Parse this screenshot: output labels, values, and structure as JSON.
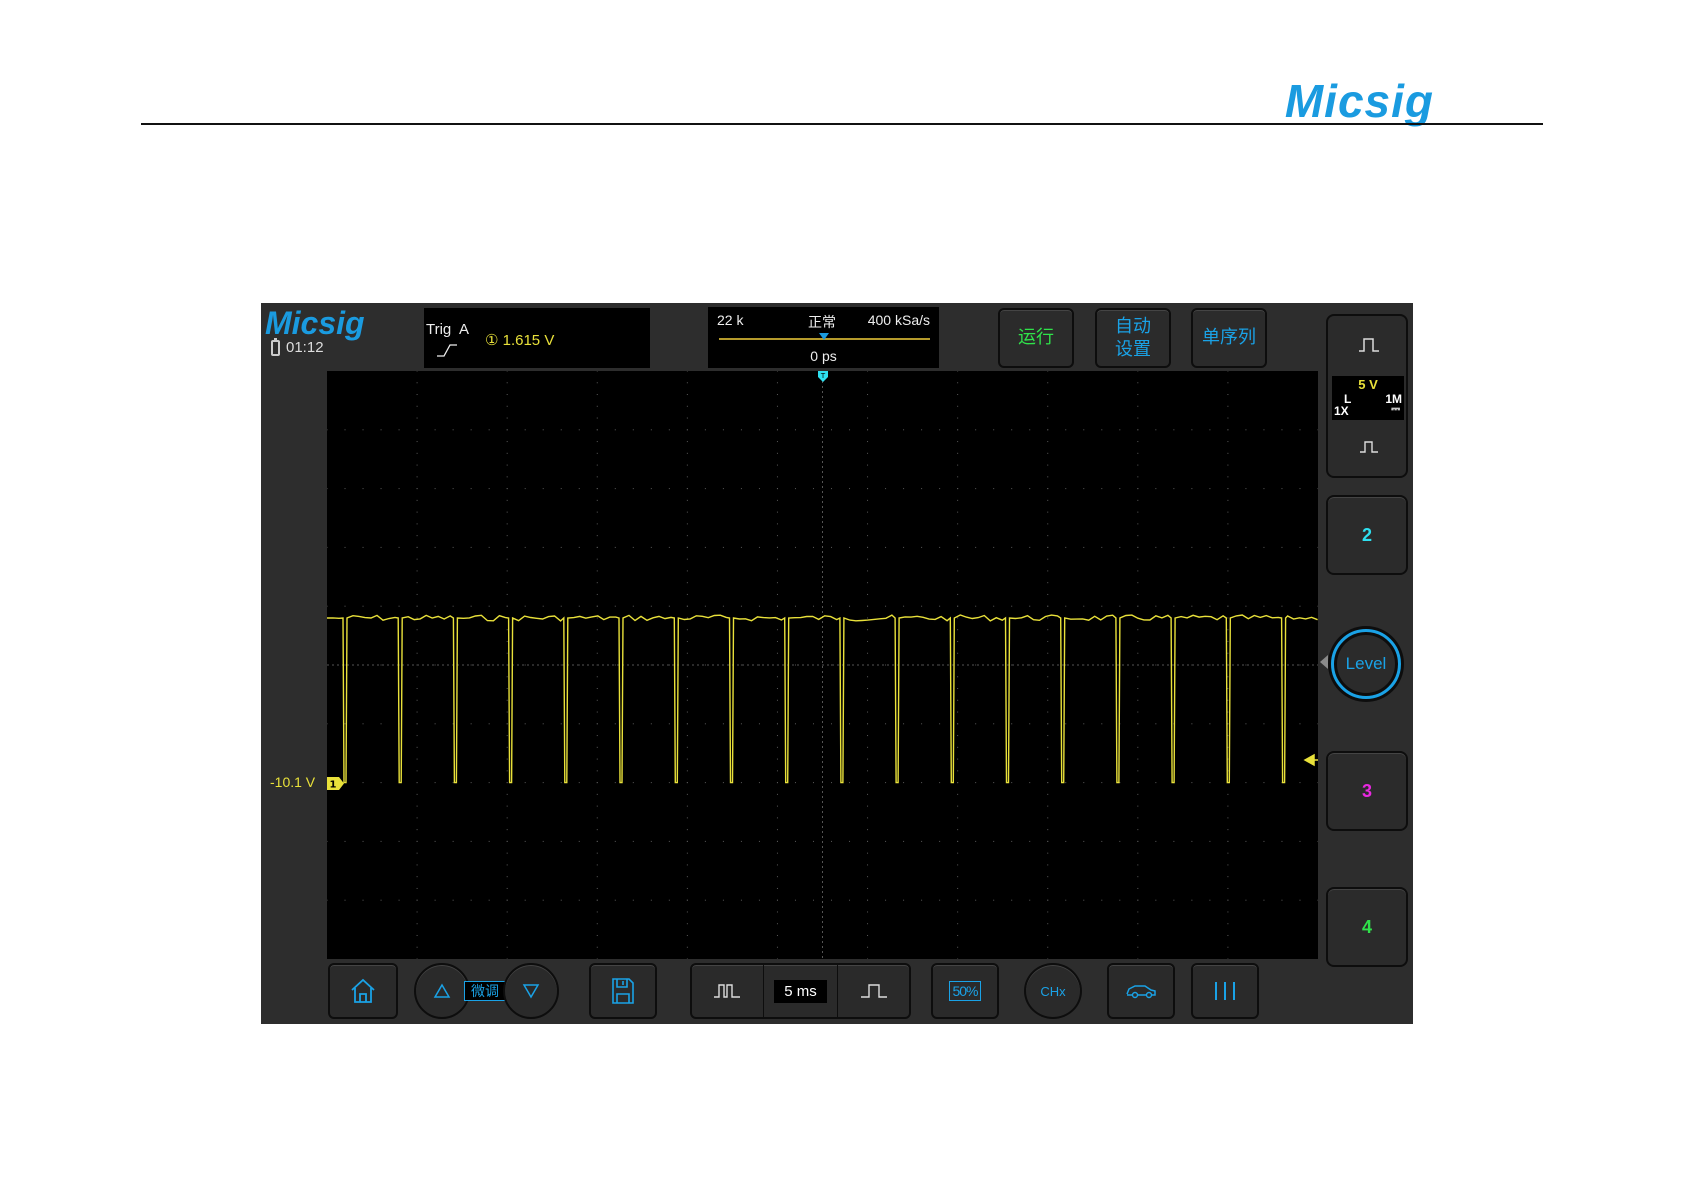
{
  "page": {
    "brand": "Micsig"
  },
  "scope": {
    "brand": "Micsig",
    "status": {
      "battery_icon": "battery-icon",
      "time": "01:12"
    },
    "trigger": {
      "label": "Trig",
      "source": "A",
      "level": "① 1.615 V",
      "edge_icon": "rising-edge-icon"
    },
    "timebase": {
      "points": "22 k",
      "mode": "正常",
      "sample_rate": "400 kSa/s",
      "offset": "0 ps"
    },
    "top_buttons": {
      "run": "运行",
      "auto_line1": "自动",
      "auto_line2": "设置",
      "single": "单序列"
    },
    "ch1": {
      "level": "-10.1 V",
      "marker": "1",
      "scale": "5 V",
      "coupling": "L",
      "impedance": "1M",
      "probe": "1X",
      "dc_symbol": "⎓"
    },
    "right_buttons": {
      "ch2": "2",
      "level": "Level",
      "ch3": "3",
      "ch4": "4"
    },
    "bottom": {
      "fine_label": "微调",
      "timebase_value": "5 ms",
      "fifty_pct": "50%",
      "chx": "CHx"
    },
    "colors": {
      "ch1": "#e9e13a",
      "ch2": "#2ee0f0",
      "ch3": "#e828e0",
      "ch4": "#2fe24a",
      "accent": "#1a9be0",
      "run": "#2fe24a"
    },
    "waveform": {
      "high_level_div": 0.8,
      "low_level_div": -2.0,
      "pulse_count": 18,
      "pulse_period_ms": 3.06
    }
  }
}
